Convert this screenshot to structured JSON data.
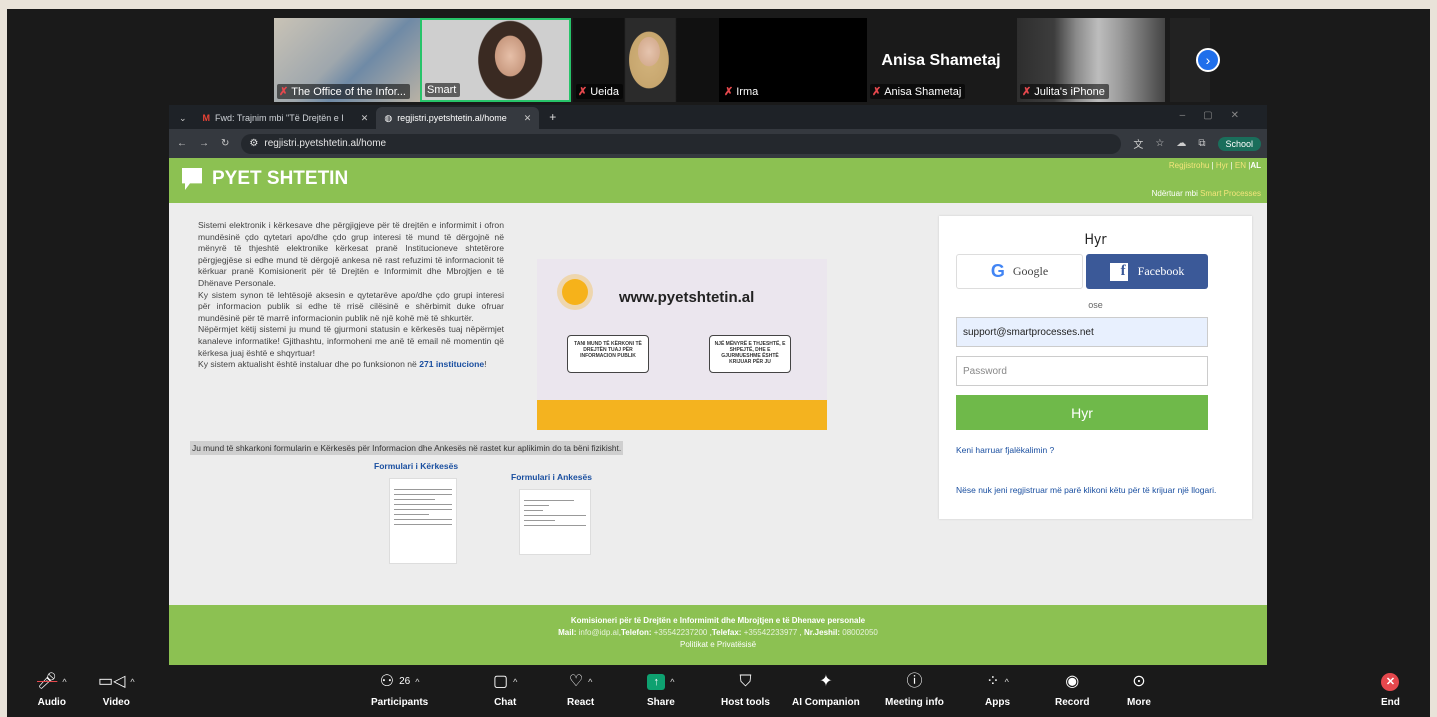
{
  "participants": [
    {
      "name": "The Office of the Infor...",
      "muted": true
    },
    {
      "name": "Smart",
      "muted": false,
      "active_speaker": true
    },
    {
      "name": "Ueida",
      "muted": true
    },
    {
      "name": "Irma",
      "muted": true
    },
    {
      "name": "Anisa Shametaj",
      "muted": true,
      "big_name": "Anisa Shametaj"
    },
    {
      "name": "Julita's iPhone",
      "muted": true
    }
  ],
  "browser": {
    "tabs": [
      {
        "title": "Fwd: Trajnim mbi \"Të Drejtën e I",
        "icon": "gmail-icon"
      },
      {
        "title": "regjistri.pyetshtetin.al/home",
        "icon": "globe-icon"
      }
    ],
    "url": "regjistri.pyetshtetin.al/home",
    "profile_label": "School"
  },
  "site": {
    "logo_text": "PYET SHTETIN",
    "toplinks": {
      "register": "Regjistrohu",
      "login": "Hyr",
      "lang_en": "EN",
      "lang_al": "AL"
    },
    "byline_prefix": "Ndërtuar mbi",
    "byline_brand": "Smart Processes",
    "intro": "Sistemi elektronik i kërkesave dhe përgjigjeve për të drejtën e informimit i ofron mundësinë çdo qytetari apo/dhe çdo grup interesi të mund të dërgojnë në mënyrë të thjeshtë elektronike kërkesat pranë Institucioneve shtetërore përgjegjëse si edhe mund të dërgojë ankesa në rast refuzimi të informacionit të kërkuar pranë Komisionerit për të Drejtën e Informimit dhe Mbrojtjen e të Dhënave Personale.",
    "intro2": "Ky sistem synon të lehtësojë aksesin e qytetarëve apo/dhe çdo grupi interesi për informacion publik si edhe të rrisë cilësinë e shërbimit duke ofruar mundësinë për të marrë informacionin publik në një kohë më të shkurtër.",
    "intro3": "Nëpërmjet këtij sistemi ju mund të gjurmoni statusin e kërkesës tuaj nëpërmjet kanaleve informatike! Gjithashtu, informoheni me anë të email në momentin që kërkesa juaj është e shqyrtuar!",
    "intro4": "Ky sistem aktualisht është instaluar dhe po funksionon në",
    "intro4_link": "271 institucione",
    "banner_url": "www.pyetshtetin.al",
    "bubble1": "TANI MUND TË KËRKONI TË DREJTËN TUAJ PËR INFORMACION PUBLIK",
    "bubble2": "NJË MËNYRË E THJESHTË, E SHPEJTË, DHE E GJURMUESHME ËSHTË KRIJUAR PËR JU",
    "download_note": "Ju mund të shkarkoni formularin e Kërkesës për Informacion dhe Ankesës në rastet kur aplikimin do ta bëni fizikisht.",
    "form_request": "Formulari i Kërkesës",
    "form_complaint": "Formulari i Ankesës",
    "login": {
      "title": "Hyr",
      "google": "Google",
      "facebook": "Facebook",
      "or": "ose",
      "email_value": "support@smartprocesses.net",
      "password_placeholder": "Password",
      "submit": "Hyr",
      "forgot": "Keni harruar fjalëkalimin ?",
      "register": "Nëse nuk jeni regjistruar më parë klikoni këtu për të krijuar një llogari."
    },
    "footer": {
      "title": "Komisioneri për të Drejtën e Informimit dhe Mbrojtjen e të Dhenave personale",
      "mail_label": "Mail:",
      "mail": "info@idp.al",
      "tel_label": "Telefon:",
      "tel": "+35542237200",
      "fax_label": "Telefax:",
      "fax": "+35542233977",
      "free_label": "Nr.Jeshil:",
      "free": "08002050",
      "policy": "Politikat e Privatësisë"
    }
  },
  "toolbar": {
    "audio": "Audio",
    "video": "Video",
    "participants": "Participants",
    "participants_count": "26",
    "chat": "Chat",
    "react": "React",
    "share": "Share",
    "host_tools": "Host tools",
    "ai_companion": "AI Companion",
    "meeting_info": "Meeting info",
    "apps": "Apps",
    "record": "Record",
    "more": "More",
    "end": "End"
  },
  "colors": {
    "site_green": "#8cc152",
    "zoom_bg": "#1a1a1a",
    "speaker_border": "#27c46a",
    "end_red": "#e5484d"
  }
}
